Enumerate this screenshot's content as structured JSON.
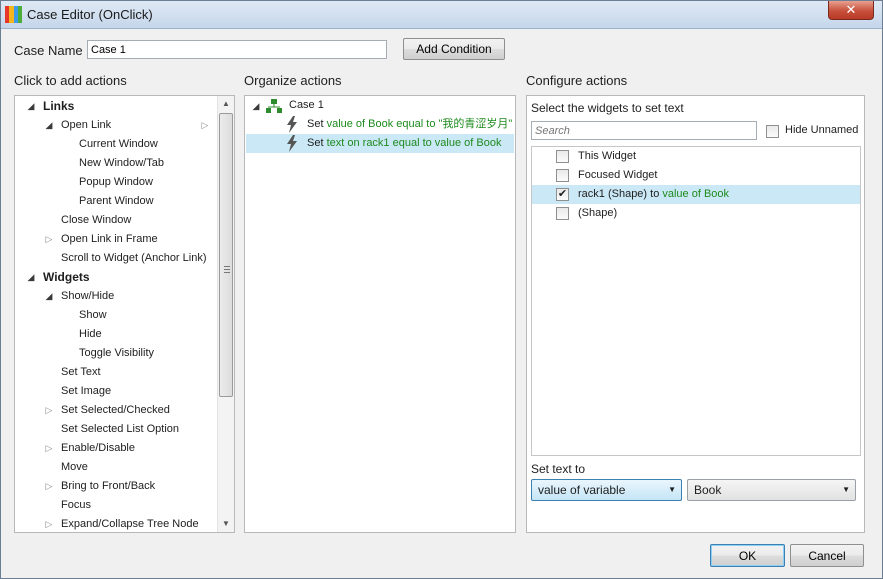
{
  "window": {
    "title": "Case Editor (OnClick)",
    "close_label": "✕",
    "icon_colors": [
      "#e8352a",
      "#f6b51d",
      "#3c9be8",
      "#4cae3a"
    ]
  },
  "case_name": {
    "label": "Case Name",
    "value": "Case 1",
    "add_condition_label": "Add Condition"
  },
  "add_actions": {
    "header": "Click to add actions",
    "items": [
      {
        "label": "Links",
        "expander": "open",
        "bold": true
      },
      {
        "label": "Open Link",
        "expander": "open"
      },
      {
        "label": "Current Window"
      },
      {
        "label": "New Window/Tab"
      },
      {
        "label": "Popup Window"
      },
      {
        "label": "Parent Window"
      },
      {
        "label": "Close Window"
      },
      {
        "label": "Open Link in Frame",
        "expander": "closed"
      },
      {
        "label": "Scroll to Widget (Anchor Link)"
      },
      {
        "label": "Widgets",
        "expander": "open",
        "bold": true
      },
      {
        "label": "Show/Hide",
        "expander": "open"
      },
      {
        "label": "Show"
      },
      {
        "label": "Hide"
      },
      {
        "label": "Toggle Visibility"
      },
      {
        "label": "Set Text"
      },
      {
        "label": "Set Image"
      },
      {
        "label": "Set Selected/Checked",
        "expander": "closed"
      },
      {
        "label": "Set Selected List Option"
      },
      {
        "label": "Enable/Disable",
        "expander": "closed"
      },
      {
        "label": "Move"
      },
      {
        "label": "Bring to Front/Back",
        "expander": "closed"
      },
      {
        "label": "Focus"
      },
      {
        "label": "Expand/Collapse Tree Node",
        "expander": "closed"
      }
    ]
  },
  "organize": {
    "header": "Organize actions",
    "case_label": "Case 1",
    "actions": [
      {
        "prefix": "Set ",
        "detail": "value of Book equal to \"我的青涩岁月\""
      },
      {
        "prefix": "Set ",
        "detail": "text on rack1 equal to value of Book"
      }
    ]
  },
  "configure": {
    "header": "Configure actions",
    "subheader": "Select the widgets to set text",
    "search_placeholder": "Search",
    "hide_unnamed_label": "Hide Unnamed",
    "widgets": [
      {
        "label": "This Widget",
        "suffix": "",
        "checked": false
      },
      {
        "label": "Focused Widget",
        "suffix": "",
        "checked": false
      },
      {
        "label": "rack1 (Shape) to ",
        "suffix": "value of Book",
        "checked": true
      },
      {
        "label": "(Shape)",
        "suffix": "",
        "checked": false
      }
    ],
    "set_text_label": "Set text to",
    "set_text_mode": "value of variable",
    "set_text_variable": "Book"
  },
  "footer": {
    "ok_label": "OK",
    "cancel_label": "Cancel"
  }
}
